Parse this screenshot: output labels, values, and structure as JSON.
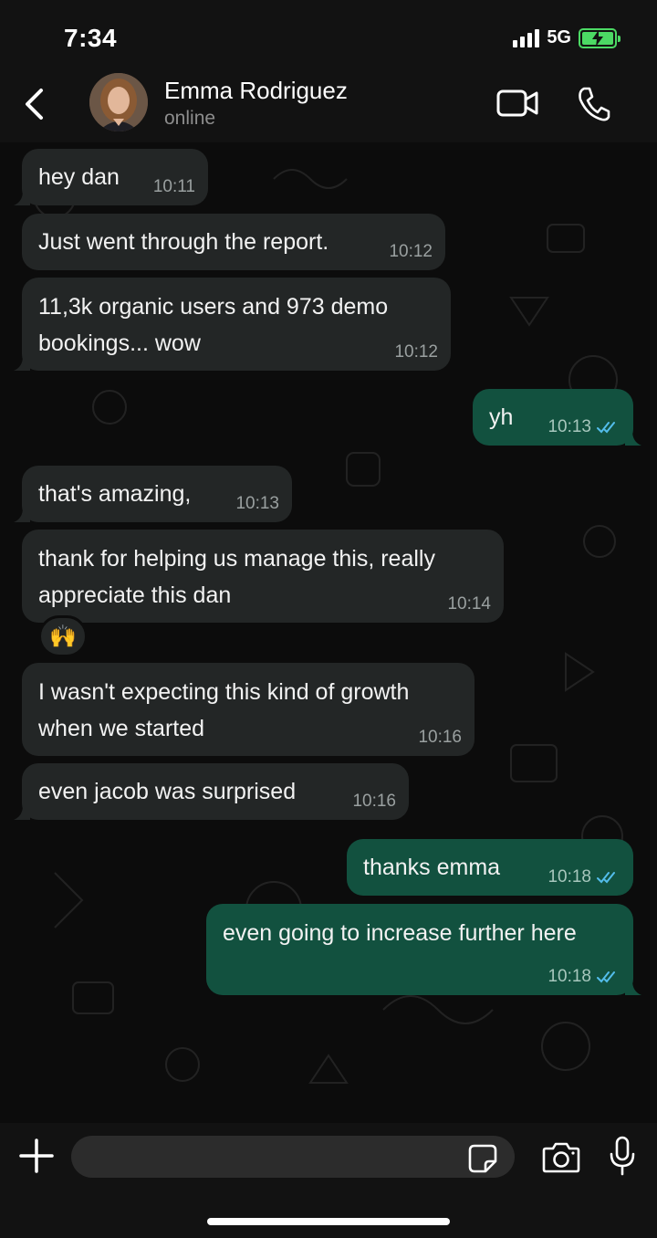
{
  "status_bar": {
    "time": "7:34",
    "network": "5G",
    "signal_icon": "signal-bars-icon",
    "battery_icon": "battery-charging-icon"
  },
  "header": {
    "back_icon": "chevron-left-icon",
    "contact_name": "Emma Rodriguez",
    "contact_status": "online",
    "video_icon": "video-camera-icon",
    "call_icon": "phone-icon"
  },
  "messages": [
    {
      "direction": "in",
      "text": "hey dan",
      "time": "10:11"
    },
    {
      "direction": "in",
      "text": "Just went through the report.",
      "time": "10:12"
    },
    {
      "direction": "in",
      "text": "11,3k organic users and 973 demo bookings... wow",
      "time": "10:12"
    },
    {
      "direction": "out",
      "text": "yh",
      "time": "10:13",
      "status": "read"
    },
    {
      "direction": "in",
      "text": "that's amazing,",
      "time": "10:13"
    },
    {
      "direction": "in",
      "text": "thank for helping us manage this, really appreciate this dan",
      "time": "10:14",
      "reaction": "🙌"
    },
    {
      "direction": "in",
      "text": "I wasn't expecting this kind of growth when we started",
      "time": "10:16"
    },
    {
      "direction": "in",
      "text": "even jacob was surprised",
      "time": "10:16"
    },
    {
      "direction": "out",
      "text": "thanks emma",
      "time": "10:18",
      "status": "read"
    },
    {
      "direction": "out",
      "text": "even going to increase further here",
      "time": "10:18",
      "status": "read"
    }
  ],
  "composer": {
    "plus_icon": "plus-icon",
    "input_value": "",
    "input_placeholder": "",
    "sticker_icon": "sticker-icon",
    "camera_icon": "camera-icon",
    "mic_icon": "microphone-icon"
  },
  "colors": {
    "incoming_bubble": "#232626",
    "outgoing_bubble": "#12513f",
    "read_ticks": "#53bdeb",
    "background": "#0c0c0c"
  }
}
